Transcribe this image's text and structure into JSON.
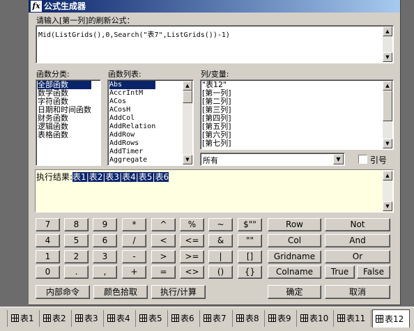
{
  "window": {
    "title": "公式生成器",
    "icon": "fx-icon"
  },
  "formula": {
    "label": "请输入[第一列]的刷新公式：",
    "value": "Mid(ListGrids(),0,Search(\"表7\",ListGrids())-1)"
  },
  "categories": {
    "label": "函数分类:",
    "items": [
      "全部函数",
      "数学函数",
      "字符函数",
      "日期和时间函数",
      "财务函数",
      "逻辑函数",
      "表格函数"
    ],
    "selected_index": 0
  },
  "functions": {
    "label": "函数列表:",
    "items": [
      "Abs",
      "AccrIntM",
      "ACos",
      "ACosH",
      "AddCol",
      "AddRelation",
      "AddRow",
      "AddRows",
      "AddTimer",
      "Aggregate"
    ],
    "selected_index": 0
  },
  "columns": {
    "label": "列/变量:",
    "items": [
      "\"表12\"",
      "[第一列]",
      "[第二列]",
      "[第三列]",
      "[第四列]",
      "[第五列]",
      "[第六列]",
      "[第七列]"
    ],
    "filter_value": "所有",
    "quote_label": "引号",
    "quote_checked": false
  },
  "result": {
    "label": "执行结果:",
    "values": [
      "表1",
      "表2",
      "表3",
      "表4",
      "表5",
      "表6"
    ],
    "separator": "|"
  },
  "keypad": {
    "rows": [
      [
        "7",
        "8",
        "9",
        "*",
        "^",
        "%",
        "~",
        "$\"\""
      ],
      [
        "4",
        "5",
        "6",
        "/",
        "<",
        "<=",
        "&",
        "\"\""
      ],
      [
        "1",
        "2",
        "3",
        "-",
        ">",
        ">=",
        "|",
        "[]"
      ],
      [
        "0",
        ".",
        ",",
        "+",
        "=",
        "<>",
        "()",
        "{}"
      ]
    ],
    "funcs": [
      [
        "Row",
        "Not"
      ],
      [
        "Col",
        "And"
      ],
      [
        "Gridname",
        "Or"
      ],
      [
        "Colname",
        "True",
        "False"
      ]
    ]
  },
  "buttons": {
    "internal": "内部命令",
    "color_pick": "颜色拾取",
    "execute": "执行/计算",
    "ok": "确定",
    "cancel": "取消"
  },
  "sheet_tabs": {
    "items": [
      "表1",
      "表2",
      "表3",
      "表4",
      "表5",
      "表6",
      "表7",
      "表8",
      "表9",
      "表10",
      "表11",
      "表12"
    ],
    "active_index": 11
  }
}
